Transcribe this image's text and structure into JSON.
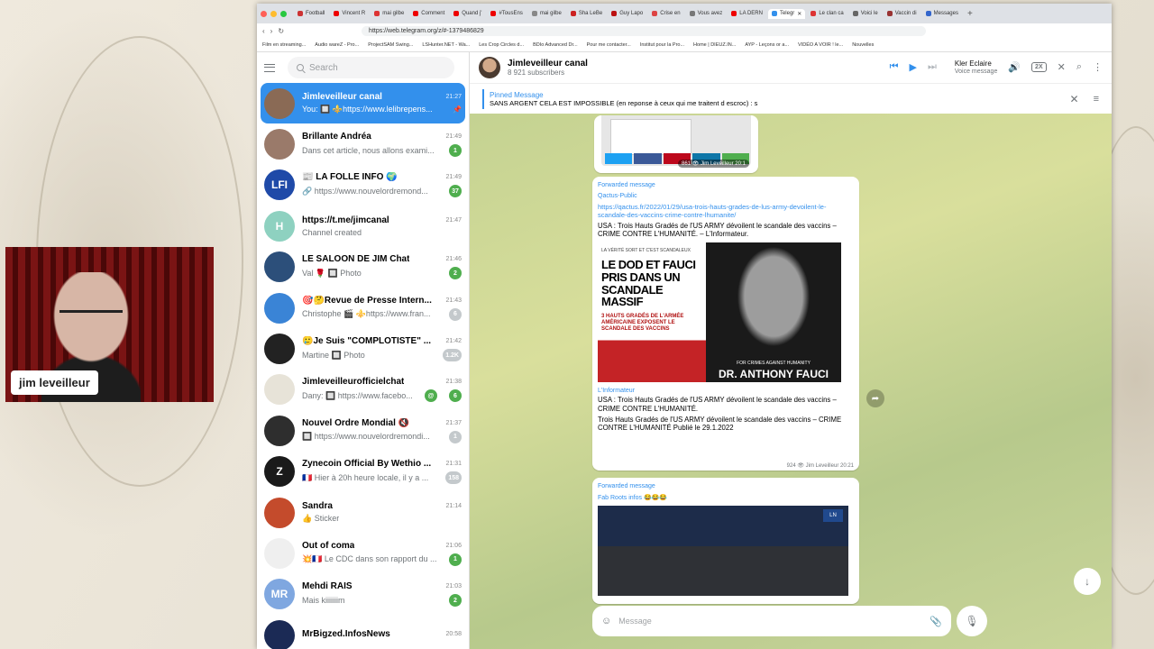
{
  "webcam": {
    "name": "jim leveilleur"
  },
  "browser": {
    "url": "https://web.telegram.org/z/#-1379486829",
    "tabs": [
      "Football",
      "Vincent R",
      "mai gilbe",
      "Comment",
      "Quand j'",
      "#TousEns",
      "mai gilbe",
      "Sha LeBe",
      "Guy Lapo",
      "Crise en",
      "Vous avez",
      "LA DERN",
      "Telegr",
      "Le clan ca",
      "Voici le",
      "Vaccin di",
      "Messages"
    ],
    "active_tab": "Telegr",
    "bookmarks": [
      "Film en streaming...",
      "Audio wareZ - Pro...",
      "ProjectSAM Swing...",
      "LSHunter.NET - Wa...",
      "Les Crop Circles d...",
      "BDIo Advanced Dr...",
      "Pour me contacter...",
      "Institut pour la Pro...",
      "Home | DIEUZ.IN...",
      "AYP - Leçons or a...",
      "VIDÉO A VOIR ! le...",
      "Nouvelles"
    ]
  },
  "sidebar": {
    "search_placeholder": "Search",
    "chats": [
      {
        "name": "Jimleveilleur canal",
        "time": "21:27",
        "preview": "You: 🔲 ⚜️https://www.lelibrepens...",
        "badge": "",
        "avatar_color": "#8a6a55",
        "active": true
      },
      {
        "name": "Brillante Andréa",
        "time": "21:49",
        "preview": "Dans cet article, nous allons exami...",
        "badge": "1",
        "avatar_color": "#9a7a6a"
      },
      {
        "name": "📰 LA FOLLE INFO 🌍",
        "time": "21:49",
        "preview": "🔗 https://www.nouvelordremond...",
        "badge": "37",
        "avatar_color": "#1f4aa8",
        "avatar_text": "LFI"
      },
      {
        "name": "https://t.me/jimcanal",
        "time": "21:47",
        "preview": "Channel created",
        "badge": "",
        "avatar_color": "#8ed1c0",
        "avatar_text": "H"
      },
      {
        "name": "LE SALOON DE JIM Chat",
        "time": "21:46",
        "preview": "Val 🌹 🔲 Photo",
        "badge": "2",
        "avatar_color": "#2c4f7a"
      },
      {
        "name": "🎯🤔Revue de Presse Intern...",
        "time": "21:43",
        "preview": "Christophe 🎬 ⚜️https://www.fran...",
        "badge": "6",
        "avatar_color": "#3a84d6",
        "muted": true
      },
      {
        "name": "🥲Je Suis \"COMPLOTISTE\" ...",
        "time": "21:42",
        "preview": "Martine 🔲 Photo",
        "badge": "1.2K",
        "avatar_color": "#222",
        "muted": true
      },
      {
        "name": "Jimleveilleurofficielchat",
        "time": "21:38",
        "preview": "Dany: 🔲 https://www.facebo...",
        "badge": "6",
        "avatar_color": "#e7e3d8",
        "mention": true
      },
      {
        "name": "Nouvel Ordre Mondial 🔇",
        "time": "21:37",
        "preview": "🔲 https://www.nouvelordremondi...",
        "badge": "1",
        "avatar_color": "#2e2e2e",
        "muted": true
      },
      {
        "name": "Zynecoin Official By Wethio ...",
        "time": "21:31",
        "preview": "🇫🇷 Hier à 20h heure locale, il y a ...",
        "badge": "158",
        "avatar_color": "#1a1a1a",
        "avatar_text": "Z",
        "muted": true
      },
      {
        "name": "Sandra",
        "time": "21:14",
        "preview": "👍 Sticker",
        "badge": "",
        "avatar_color": "#c44b2c"
      },
      {
        "name": "Out of coma",
        "time": "21:06",
        "preview": "💥🇫🇷 Le CDC dans son rapport du ...",
        "badge": "1",
        "avatar_color": "#efefef"
      },
      {
        "name": "Mehdi RAIS",
        "time": "21:03",
        "preview": "Mais kiiiiiiim",
        "badge": "2",
        "avatar_color": "#7fa7e0",
        "avatar_text": "MR"
      },
      {
        "name": "MrBigzed.InfosNews",
        "time": "20:58",
        "preview": "",
        "badge": "",
        "avatar_color": "#1b2a55"
      }
    ]
  },
  "header": {
    "title": "Jimleveilleur canal",
    "subtitle": "8 921 subscribers",
    "audio_title": "Kler Eclaire",
    "audio_sub": "Voice message",
    "speed": "2X"
  },
  "pinned": {
    "label": "Pinned Message",
    "text": "SANS ARGENT CELA EST IMPOSSIBLE (en reponse à ceux qui me traitent d escroc) : s"
  },
  "messages": {
    "m1_meta": "861 👁 Jim Leveilleur 20:1",
    "m2": {
      "forwarded": "Forwarded message",
      "from": "Qactus-Public",
      "link": "https://qactus.fr/2022/01/29/usa-trois-hauts-grades-de-lus-army-devoilent-le-scandale-des-vaccins-crime-contre-lhumanite/",
      "text": "USA : Trois Hauts Gradés de l'US ARMY dévoilent le scandale des vaccins – CRIME CONTRE L'HUMANITÉ. – L'Informateur.",
      "poster_kicker": "LA VÉRITÉ SORT ET C'EST SCANDALEUX",
      "poster_head": "LE DOD ET FAUCI PRIS DANS UN SCANDALE MASSIF",
      "poster_sub": "3 HAUTS GRADÉS DE L'ARMÉE AMÉRICAINE EXPOSENT LE SCANDALE DES VACCINS",
      "poster_cap1": "FOR CRIMES AGAINST HUMANITY",
      "poster_cap2": "DR. ANTHONY FAUCI",
      "site": "L'Informateur",
      "site_text": "USA : Trois Hauts Gradés de l'US ARMY dévoilent le scandale des vaccins – CRIME CONTRE L'HUMANITÉ.",
      "site_text2": "Trois Hauts Gradés de l'US ARMY dévoilent le scandale des vaccins – CRIME CONTRE L'HUMANITÉ Publié le 29.1.2022",
      "meta": "924 👁 Jim Leveilleur 20:21"
    },
    "m3": {
      "forwarded": "Forwarded message",
      "from": "Fab Roots infos 😂😂😂",
      "logo": "LN"
    }
  },
  "composer": {
    "placeholder": "Message"
  }
}
